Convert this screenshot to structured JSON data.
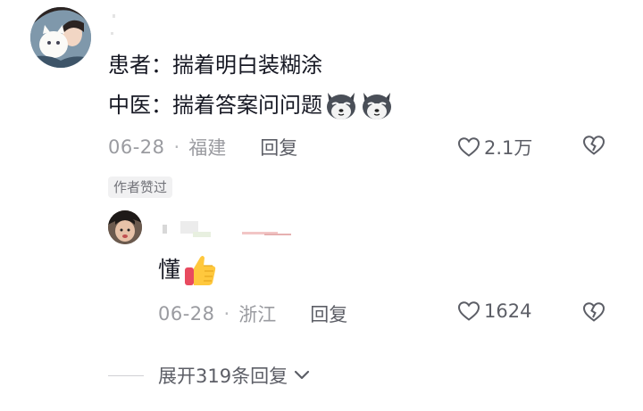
{
  "comment": {
    "line1": "患者：揣着明白装糊涂",
    "line2": "中医：揣着答案问问题",
    "date": "06-28",
    "location": "福建",
    "reply_label": "回复",
    "like_count": "2.1万",
    "author_badge": "作者赞过",
    "emoji": "husky-dog-emoji"
  },
  "reply": {
    "text": "懂",
    "date": "06-28",
    "location": "浙江",
    "reply_label": "回复",
    "like_count": "1624",
    "emoji": "thumbs-up-emoji"
  },
  "expand": {
    "label": "展开319条回复"
  },
  "colors": {
    "text": "#161823",
    "meta": "#9a9ba0",
    "action": "#5c5e66",
    "badge_bg": "#f1f1f2"
  }
}
